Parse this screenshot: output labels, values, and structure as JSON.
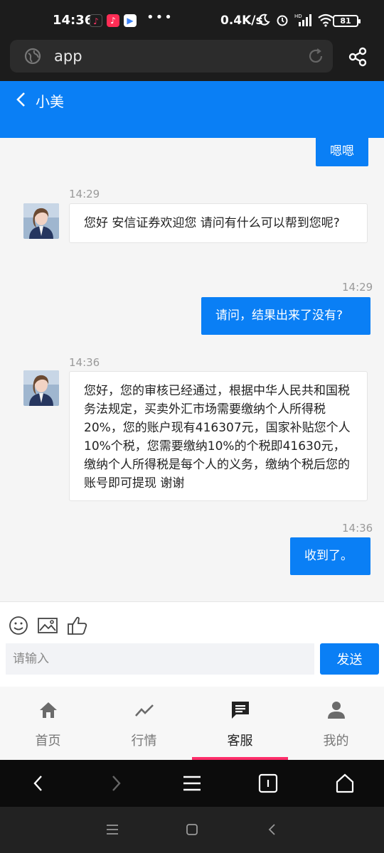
{
  "status_bar": {
    "time": "14:36",
    "net_speed": "0.4K/s",
    "network_label": "HD",
    "battery": "81"
  },
  "browser": {
    "url": "app"
  },
  "chat": {
    "title": "小美",
    "messages": [
      {
        "from": "me",
        "text": "嗯嗯"
      },
      {
        "from": "agent",
        "time": "14:29",
        "text": "您好 安信证券欢迎您 请问有什么可以帮到您呢?"
      },
      {
        "from": "me",
        "time": "14:29",
        "text": "请问，结果出来了没有?"
      },
      {
        "from": "agent",
        "time": "14:36",
        "text": "您好，您的审核已经通过，根据中华人民共和国税务法规定，买卖外汇市场需要缴纳个人所得税20%，您的账户现有416307元，国家补贴您个人10%个税，您需要缴纳10%的个税即41630元，缴纳个人所得税是每个人的义务，缴纳个税后您的账号即可提现 谢谢"
      },
      {
        "from": "me",
        "time": "14:36",
        "text": "收到了。"
      }
    ]
  },
  "input": {
    "placeholder": "请输入",
    "send_label": "发送"
  },
  "tabs": [
    {
      "label": "首页",
      "icon": "home-icon"
    },
    {
      "label": "行情",
      "icon": "trend-icon"
    },
    {
      "label": "客服",
      "icon": "chat-icon",
      "active": true
    },
    {
      "label": "我的",
      "icon": "person-icon"
    }
  ],
  "colors": {
    "accent": "#0a7ff5",
    "tab_indicator": "#ff2d6a"
  }
}
